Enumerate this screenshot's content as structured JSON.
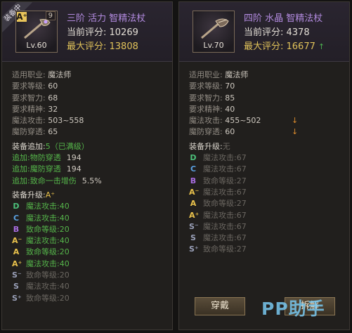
{
  "left": {
    "equipped_tag": "装备中",
    "slot_number": "9",
    "grade_badge": "A⁺",
    "level": "Lv.60",
    "item_name": "三阶 活力 智精法杖",
    "current_score": "当前评分: 10269",
    "max_score": "最大评分: 13808",
    "stats": [
      {
        "label": "适用职业: ",
        "value": "魔法师"
      },
      {
        "label": "要求等级: ",
        "value": "60"
      },
      {
        "label": "要求智力: ",
        "value": "68"
      },
      {
        "label": "要求精神: ",
        "value": "32"
      },
      {
        "label": "魔法攻击: ",
        "value": "503~558"
      },
      {
        "label": "魔防穿透: ",
        "value": "65"
      }
    ],
    "enhance_title": "装备追加:",
    "enhance_value": "5（已满级）",
    "enhance_items": [
      {
        "label": "追加:物防穿透",
        "value": "194"
      },
      {
        "label": "追加:魔防穿透",
        "value": "194"
      },
      {
        "label": "追加:致命一击增伤",
        "value": "5.5%"
      }
    ],
    "upgrade_title": "装备升级:",
    "upgrade_grade": "A⁺",
    "upgrades": [
      {
        "grade": "D",
        "cls": "g-D",
        "text": "魔法攻击:40",
        "active": true
      },
      {
        "grade": "C",
        "cls": "g-C",
        "text": "魔法攻击:40",
        "active": true
      },
      {
        "grade": "B",
        "cls": "g-B",
        "text": "致命等级:20",
        "active": true
      },
      {
        "grade": "A⁻",
        "cls": "g-Ap",
        "text": "魔法攻击:40",
        "active": true
      },
      {
        "grade": "A",
        "cls": "g-A",
        "text": "致命等级:20",
        "active": true
      },
      {
        "grade": "A⁺",
        "cls": "g-Ap",
        "text": "魔法攻击:40",
        "active": true
      },
      {
        "grade": "S⁻",
        "cls": "g-S",
        "text": "致命等级:20",
        "active": false
      },
      {
        "grade": "S",
        "cls": "g-S",
        "text": "魔法攻击:40",
        "active": false
      },
      {
        "grade": "S⁺",
        "cls": "g-S",
        "text": "致命等级:20",
        "active": false
      }
    ]
  },
  "right": {
    "level": "Lv.70",
    "item_name": "四阶 水晶 智精法杖",
    "current_score": "当前评分: 4378",
    "max_score": "最大评分: 16677",
    "max_score_arrow": "↑",
    "stats": [
      {
        "label": "适用职业: ",
        "value": "魔法师",
        "down": false
      },
      {
        "label": "要求等级: ",
        "value": "70",
        "down": false
      },
      {
        "label": "要求智力: ",
        "value": "85",
        "down": false
      },
      {
        "label": "要求精神: ",
        "value": "40",
        "down": false
      },
      {
        "label": "魔法攻击: ",
        "value": "455~502",
        "down": true
      },
      {
        "label": "魔防穿透: ",
        "value": "60",
        "down": true
      }
    ],
    "down_arrow": "↓",
    "upgrade_title": "装备升级:",
    "upgrade_value": "无",
    "upgrades": [
      {
        "grade": "D",
        "cls": "g-D",
        "text": "魔法攻击:67"
      },
      {
        "grade": "C",
        "cls": "g-C",
        "text": "魔法攻击:67"
      },
      {
        "grade": "B",
        "cls": "g-B",
        "text": "致命等级:27"
      },
      {
        "grade": "A⁻",
        "cls": "g-Ap",
        "text": "魔法攻击:67"
      },
      {
        "grade": "A",
        "cls": "g-A",
        "text": "致命等级:27"
      },
      {
        "grade": "A⁺",
        "cls": "g-Ap",
        "text": "魔法攻击:67"
      },
      {
        "grade": "S⁻",
        "cls": "g-S",
        "text": "魔法攻击:67"
      },
      {
        "grade": "S",
        "cls": "g-S",
        "text": "魔法攻击:67"
      },
      {
        "grade": "S⁺",
        "cls": "g-S",
        "text": "致命等级:27"
      }
    ],
    "wear_button": "穿戴",
    "decompose_button": "拆解"
  },
  "watermark": {
    "prefix": "PP",
    "suffix": "助手"
  },
  "colors": {
    "item_name": "#b38be0",
    "max_score": "#e0c25a",
    "green": "#55b54a",
    "down_arrow": "#d98a2d"
  }
}
